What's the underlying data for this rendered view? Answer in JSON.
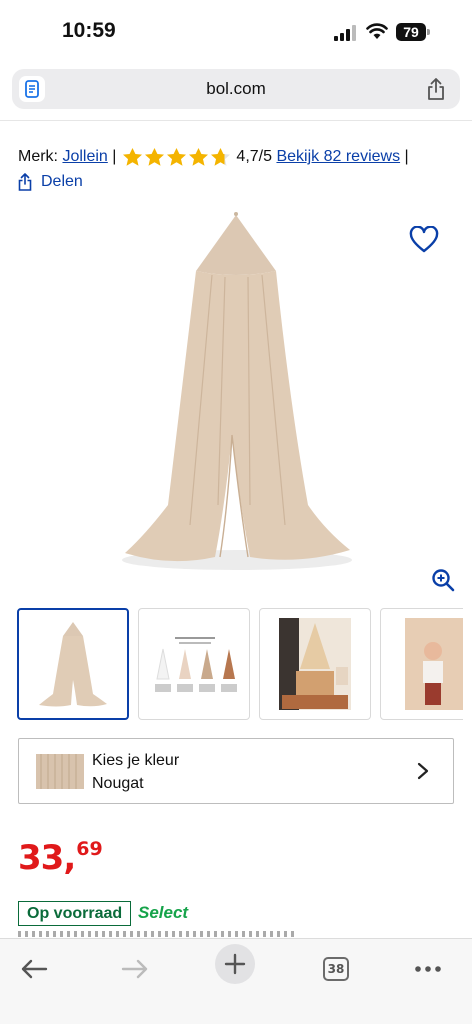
{
  "status_bar": {
    "time": "10:59",
    "battery": "79"
  },
  "browser": {
    "url": "bol.com"
  },
  "product": {
    "brand_label": "Merk:",
    "brand": "Jollein",
    "separator": "|",
    "rating": 4.7,
    "rating_text": "4,7/5",
    "reviews_link": "Bekijk 82 reviews",
    "separator_end": "|",
    "share_label": "Delen"
  },
  "colors": {
    "accent_blue": "#0a3fa8",
    "price_red": "#e0191a",
    "stock_green": "#0a6b3a",
    "select_green": "#16a34a",
    "star": "#f4b400"
  },
  "thumbnails": [
    "canopy-product",
    "color-variants",
    "nursery-room",
    "child-room"
  ],
  "color_picker": {
    "label": "Kies je kleur",
    "value": "Nougat"
  },
  "price": {
    "main": "33,",
    "cents": "69"
  },
  "availability": {
    "stock": "Op voorraad",
    "select": "Select"
  },
  "toolbar": {
    "tab_count": "38"
  }
}
